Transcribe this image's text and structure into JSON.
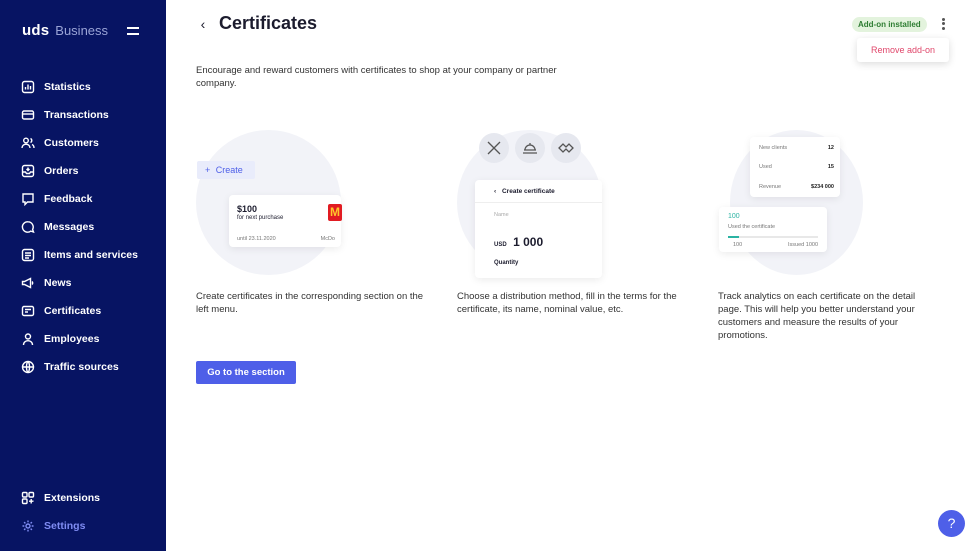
{
  "sidebar": {
    "brand_main": "uds",
    "brand_sub": "Business",
    "items": [
      {
        "label": "Statistics",
        "icon": "chart-icon"
      },
      {
        "label": "Transactions",
        "icon": "transactions-icon"
      },
      {
        "label": "Customers",
        "icon": "users-icon"
      },
      {
        "label": "Orders",
        "icon": "orders-icon"
      },
      {
        "label": "Feedback",
        "icon": "feedback-icon"
      },
      {
        "label": "Messages",
        "icon": "message-icon"
      },
      {
        "label": "Items and services",
        "icon": "items-icon"
      },
      {
        "label": "News",
        "icon": "news-icon"
      },
      {
        "label": "Certificates",
        "icon": "certificate-icon"
      },
      {
        "label": "Employees",
        "icon": "employee-icon"
      },
      {
        "label": "Traffic sources",
        "icon": "globe-icon"
      }
    ],
    "bottom_items": [
      {
        "label": "Extensions",
        "icon": "extensions-icon"
      },
      {
        "label": "Settings",
        "icon": "gear-icon"
      }
    ]
  },
  "header": {
    "title": "Certificates",
    "badge": "Add-on installed",
    "popup_item": "Remove add-on"
  },
  "intro": "Encourage and reward customers with certificates to shop at your company or partner company.",
  "illus1": {
    "create_label": "Create",
    "amount": "$100",
    "purpose": "for next purchase",
    "until": "until 23.11.2020",
    "partner": "McDo"
  },
  "illus2": {
    "heading": "Create certificate",
    "name_label": "Name",
    "currency": "USD",
    "value": "1 000",
    "quantity_label": "Quantity"
  },
  "illus3": {
    "rows": [
      {
        "label": "New clients",
        "value": "12"
      },
      {
        "label": "Used",
        "value": "15"
      },
      {
        "label": "Revenue",
        "value": "$234 000"
      }
    ],
    "used_count": "100",
    "used_label": "Used the certificate",
    "left_small": "100",
    "right_small": "Issued 1000"
  },
  "steps": [
    "Create certificates in the corresponding section on the left menu.",
    "Choose a distribution method, fill in the terms for the certificate, its name, nominal value, etc.",
    "Track analytics on each certificate on the detail page. This will help you better understand your customers and measure the results of your promotions."
  ],
  "cta": "Go to the section",
  "help": "?",
  "colors": {
    "sidebar": "#071463",
    "accent": "#4e5fe8",
    "settings_active": "#7f8cf2",
    "badge_bg": "#e3f3dd",
    "danger": "#e0476b"
  }
}
